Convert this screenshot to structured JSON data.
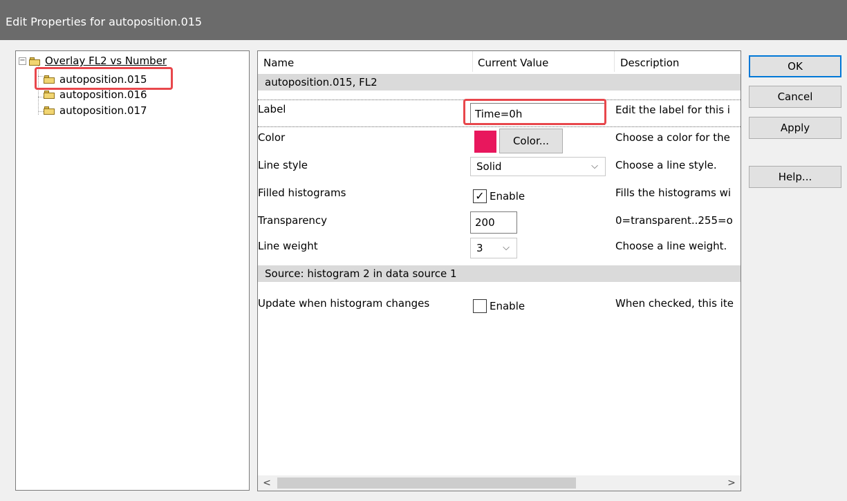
{
  "window": {
    "title": "Edit Properties for autoposition.015"
  },
  "tree": {
    "expander_symbol": "−",
    "root_label": "Overlay FL2 vs Number",
    "children": [
      {
        "label": "autoposition.015"
      },
      {
        "label": "autoposition.016"
      },
      {
        "label": "autoposition.017"
      }
    ]
  },
  "grid": {
    "columns": {
      "name": "Name",
      "value": "Current Value",
      "description": "Description"
    },
    "section1": "autoposition.015, FL2",
    "section2": "Source: histogram 2 in data source 1",
    "properties": {
      "label": {
        "name": "Label",
        "value": "Time=0h",
        "description": "Edit the label for this i"
      },
      "color": {
        "name": "Color",
        "button": "Color...",
        "description": "Choose a color for the",
        "swatch": "#e8175d"
      },
      "line_style": {
        "name": "Line style",
        "value": "Solid",
        "description": "Choose a line style."
      },
      "filled_histograms": {
        "name": "Filled histograms",
        "checked": true,
        "check_label": "Enable",
        "description": "Fills the histograms wi"
      },
      "transparency": {
        "name": "Transparency",
        "value": "200",
        "description": "0=transparent..255=o"
      },
      "line_weight": {
        "name": "Line weight",
        "value": "3",
        "description": "Choose a line weight."
      },
      "update": {
        "name": "Update when histogram changes",
        "checked": false,
        "check_label": "Enable",
        "description": "When checked, this ite"
      }
    },
    "scroll": {
      "left": "<",
      "right": ">"
    }
  },
  "buttons": {
    "ok": "OK",
    "cancel": "Cancel",
    "apply": "Apply",
    "help": "Help..."
  },
  "icons": {
    "checkmark": "✓",
    "dropdown": "⌵"
  },
  "colors": {
    "highlight": "#e8474c",
    "default_button_border": "#0078d7"
  }
}
